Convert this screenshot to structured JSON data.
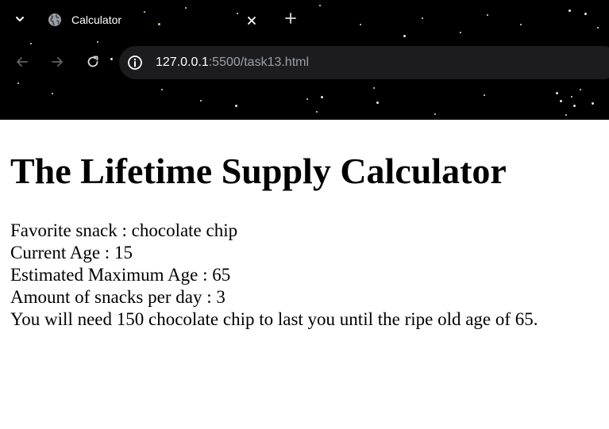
{
  "browser": {
    "tab_title": "Calculator",
    "url_host": "127.0.0.1",
    "url_path": ":5500/task13.html"
  },
  "page": {
    "title": "The Lifetime Supply Calculator",
    "lines": [
      "Favorite snack : chocolate chip",
      "Current Age : 15",
      "Estimated Maximum Age : 65",
      "Amount of snacks per day : 3",
      "You will need 150 chocolate chip to last you until the ripe old age of 65."
    ]
  },
  "icons": {
    "tab_search": "chevron-down-icon",
    "favicon": "globe-icon",
    "tab_close": "close-icon",
    "new_tab": "plus-icon",
    "back": "arrow-left-icon",
    "forward": "arrow-right-icon",
    "reload": "reload-icon",
    "site_info": "info-icon"
  },
  "colors": {
    "chrome_background": "#000000",
    "omnibox_background": "#1c1c1e",
    "url_host": "#ffffff",
    "url_path": "#9aa0a6",
    "disabled_nav": "#5f6368",
    "page_background": "#ffffff",
    "text": "#000000"
  }
}
